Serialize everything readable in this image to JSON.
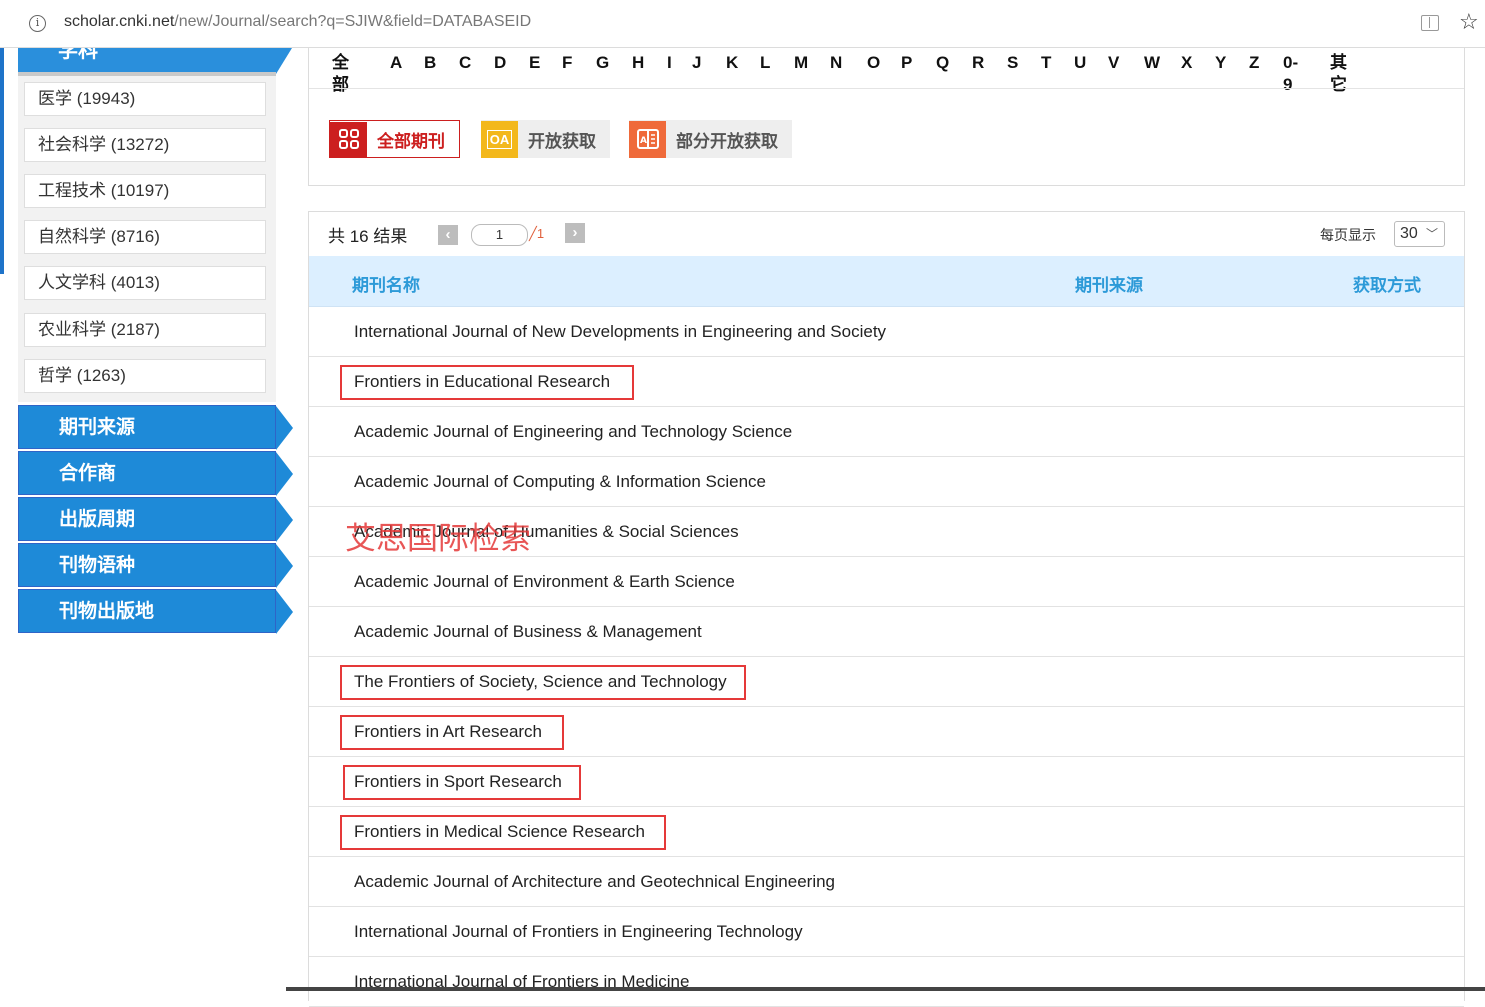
{
  "browser": {
    "url_host": "scholar.cnki.net",
    "url_path": "/new/Journal/search?q=SJIW&field=DATABASEID"
  },
  "sidebar": {
    "subject_header": "学科",
    "subjects": [
      {
        "label": "医学 (19943)"
      },
      {
        "label": "社会科学 (13272)"
      },
      {
        "label": "工程技术 (10197)"
      },
      {
        "label": "自然科学 (8716)"
      },
      {
        "label": "人文学科 (4013)"
      },
      {
        "label": "农业科学 (2187)"
      },
      {
        "label": "哲学 (1263)"
      }
    ],
    "nav": [
      {
        "label": "期刊来源"
      },
      {
        "label": "合作商"
      },
      {
        "label": "出版周期"
      },
      {
        "label": "刊物语种"
      },
      {
        "label": "刊物出版地"
      }
    ]
  },
  "filter": {
    "letters": [
      "全部",
      "A",
      "B",
      "C",
      "D",
      "E",
      "F",
      "G",
      "H",
      "I",
      "J",
      "K",
      "L",
      "M",
      "N",
      "O",
      "P",
      "Q",
      "R",
      "S",
      "T",
      "U",
      "V",
      "W",
      "X",
      "Y",
      "Z",
      "0-9",
      "其它"
    ],
    "access_all": "全部期刊",
    "access_oa": "开放获取",
    "access_partial": "部分开放获取",
    "oa_icon_text": "OA"
  },
  "results": {
    "count_text": "共 16 结果",
    "page_current": "1",
    "page_total": "╱1",
    "per_page_label": "每页显示",
    "per_page_value": "30",
    "columns": {
      "name": "期刊名称",
      "source": "期刊来源",
      "access": "获取方式"
    },
    "rows": [
      {
        "name": "International Journal of New Developments in Engineering and Society",
        "highlighted": false
      },
      {
        "name": "Frontiers in Educational Research",
        "highlighted": true
      },
      {
        "name": "Academic Journal of Engineering and Technology Science",
        "highlighted": false
      },
      {
        "name": "Academic Journal of Computing & Information Science",
        "highlighted": false
      },
      {
        "name": "Academic Journal of Humanities & Social Sciences",
        "highlighted": false
      },
      {
        "name": "Academic Journal of Environment & Earth Science",
        "highlighted": false
      },
      {
        "name": "Academic Journal of Business & Management",
        "highlighted": false
      },
      {
        "name": "The Frontiers of Society, Science and Technology",
        "highlighted": true
      },
      {
        "name": "Frontiers in Art Research",
        "highlighted": true
      },
      {
        "name": "Frontiers in Sport Research",
        "highlighted": true
      },
      {
        "name": "Frontiers in Medical Science Research",
        "highlighted": true
      },
      {
        "name": "Academic Journal of Architecture and Geotechnical Engineering",
        "highlighted": false
      },
      {
        "name": "International Journal of Frontiers in Engineering Technology",
        "highlighted": false
      },
      {
        "name": "International Journal of Frontiers in Medicine",
        "highlighted": false
      }
    ]
  },
  "watermark": "艾思国际检索",
  "colors": {
    "accent_blue": "#1e8ad8",
    "highlight_red": "#e53939",
    "header_blue_text": "#2d9ad8"
  }
}
